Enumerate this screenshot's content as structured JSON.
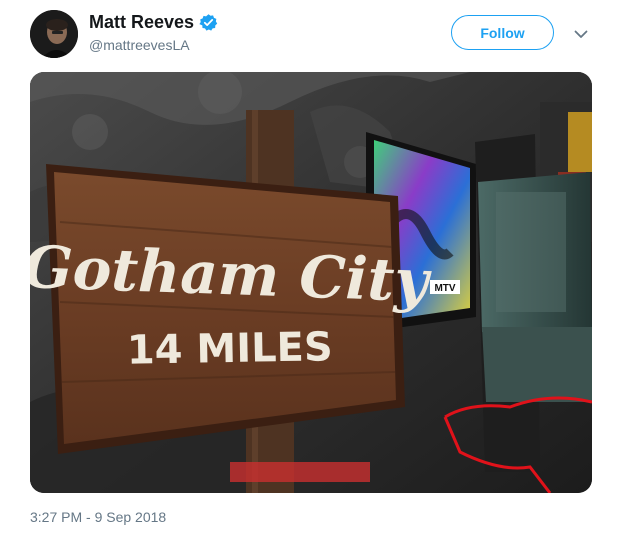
{
  "author": {
    "display_name": "Matt Reeves",
    "handle": "@mattreevesLA",
    "verified": true,
    "avatar_icon": "profile-photo"
  },
  "actions": {
    "follow_label": "Follow",
    "more_icon": "chevron-down-icon"
  },
  "media": {
    "sign_line1": "Gotham City",
    "sign_line2": "14 MILES",
    "tv_badge": "MTV"
  },
  "footer": {
    "timestamp": "3:27 PM - 9 Sep 2018"
  },
  "colors": {
    "accent": "#1da1f2",
    "muted_text": "#657786",
    "primary_text": "#14171a",
    "sign_wood": "#6b3d24",
    "neon_red": "#e0121a"
  }
}
